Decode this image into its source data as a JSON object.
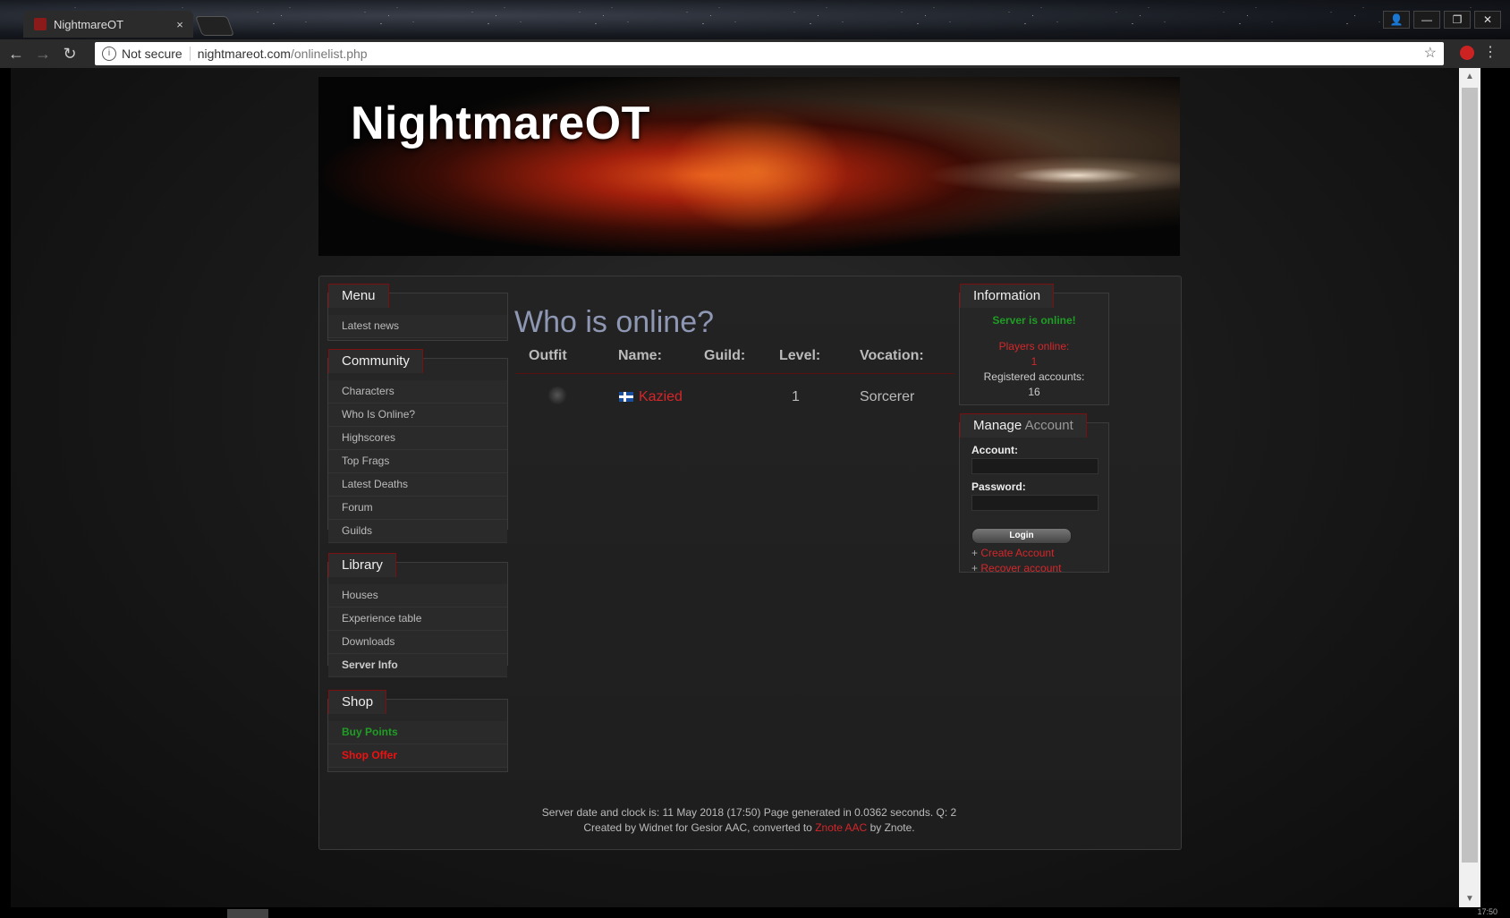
{
  "browser": {
    "tab_title": "NightmareOT",
    "tab_close": "×",
    "security_label": "Not secure",
    "url_host": "nightmareot.com",
    "url_path": "/onlinelist.php",
    "back": "←",
    "forward": "→",
    "reload": "↻",
    "star": "☆",
    "menu": "⋮",
    "win_user": "👤",
    "win_min": "—",
    "win_max": "❐",
    "win_close": "✕",
    "scroll_up": "▲",
    "scroll_down": "▼"
  },
  "site": {
    "title": "NightmareOT"
  },
  "sidebar": {
    "menu": {
      "heading": "Menu",
      "items": [
        "Latest news"
      ]
    },
    "community": {
      "heading": "Community",
      "items": [
        "Characters",
        "Who Is Online?",
        "Highscores",
        "Top Frags",
        "Latest Deaths",
        "Forum",
        "Guilds"
      ]
    },
    "library": {
      "heading": "Library",
      "items": [
        "Houses",
        "Experience table",
        "Downloads",
        "Server Info"
      ]
    },
    "shop": {
      "heading": "Shop",
      "items": [
        "Buy Points",
        "Shop Offer"
      ]
    }
  },
  "main": {
    "title": "Who is online?",
    "columns": [
      "Outfit",
      "Name:",
      "Guild:",
      "Level:",
      "Vocation:"
    ],
    "rows": [
      {
        "outfit": "",
        "name": "Kazied",
        "guild": "",
        "level": "1",
        "vocation": "Sorcerer"
      }
    ]
  },
  "information": {
    "heading": "Information",
    "status": "Server is online!",
    "players_label": "Players online:",
    "players_value": "1",
    "accounts_label": "Registered accounts:",
    "accounts_value": "16"
  },
  "manage": {
    "heading_a": "Manage",
    "heading_b": "Account",
    "account_label": "Account:",
    "password_label": "Password:",
    "login_button": "Login",
    "plus": "+",
    "create_account": "Create Account",
    "recover_account": "Recover account"
  },
  "footer": {
    "line1": "Server date and clock is: 11 May 2018 (17:50) Page generated in 0.0362 seconds. Q: 2",
    "line2_a": "Created by Widnet for Gesior AAC, converted to",
    "line2_link": "Znote AAC",
    "line2_b": "by Znote."
  },
  "taskbar": {
    "clock": "17:50"
  },
  "colors": {
    "accent_red": "#d5262a",
    "online_green": "#1f9d24",
    "title_blue": "#8e97b3"
  }
}
